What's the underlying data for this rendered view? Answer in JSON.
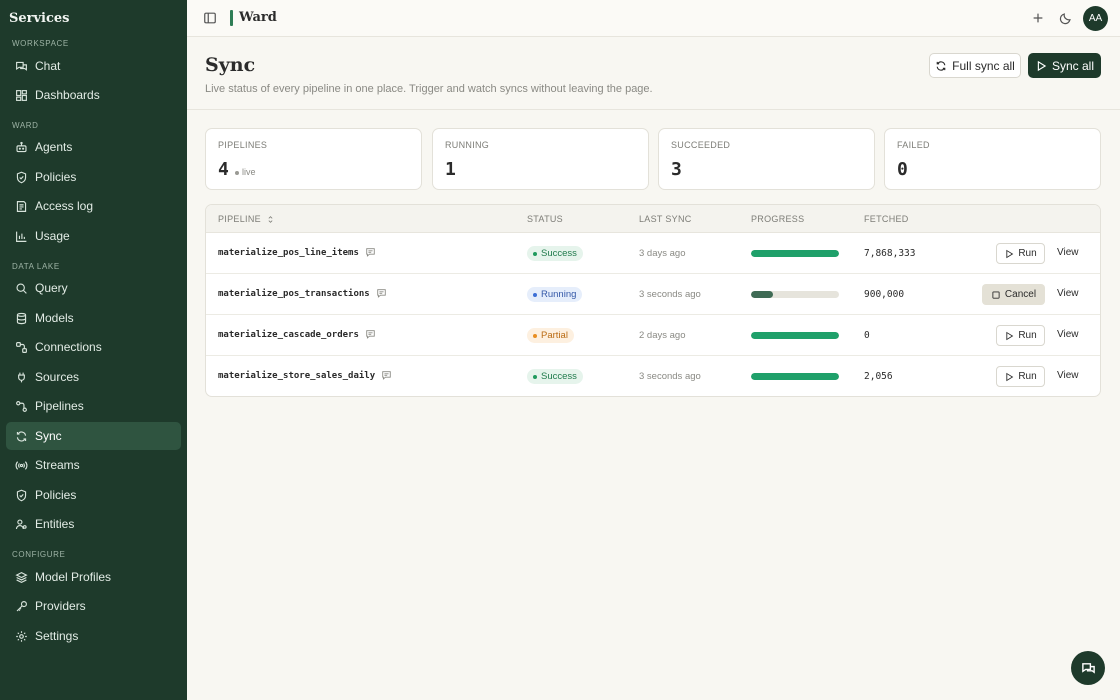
{
  "sidebar": {
    "brand": "Services",
    "sections": {
      "workspace": "WORKSPACE",
      "ward": "WARD",
      "data_lake": "DATA LAKE",
      "configure": "CONFIGURE"
    },
    "items": {
      "chat": "Chat",
      "dashboards": "Dashboards",
      "agents": "Agents",
      "policies_ward": "Policies",
      "access_log": "Access log",
      "usage": "Usage",
      "query": "Query",
      "models": "Models",
      "connections": "Connections",
      "sources": "Sources",
      "pipelines": "Pipelines",
      "sync": "Sync",
      "streams": "Streams",
      "policies_lake": "Policies",
      "entities": "Entities",
      "model_profiles": "Model Profiles",
      "providers": "Providers",
      "settings": "Settings"
    },
    "active_item": "Sync"
  },
  "topbar": {
    "workspace_name": "Ward",
    "avatar_initials": "AA"
  },
  "page": {
    "title": "Sync",
    "subtitle": "Live status of every pipeline in one place. Trigger and watch syncs without leaving the page.",
    "full_sync_label": "Full sync all",
    "sync_all_label": "Sync all"
  },
  "stats": {
    "pipelines": {
      "label": "PIPELINES",
      "value": "4",
      "note": "live"
    },
    "running": {
      "label": "RUNNING",
      "value": "1"
    },
    "succeeded": {
      "label": "SUCCEEDED",
      "value": "3"
    },
    "failed": {
      "label": "FAILED",
      "value": "0"
    }
  },
  "table": {
    "headers": {
      "pipeline": "PIPELINE",
      "status": "STATUS",
      "last_sync": "LAST SYNC",
      "progress": "PROGRESS",
      "fetched": "FETCHED"
    },
    "rows": [
      {
        "name": "materialize_pos_line_items",
        "status": "Success",
        "last_sync": "3 days ago",
        "progress": 1.0,
        "fetched": "7,868,333",
        "action": "Run",
        "view": "View"
      },
      {
        "name": "materialize_pos_transactions",
        "status": "Running",
        "last_sync": "3 seconds ago",
        "progress": 0.25,
        "fetched": "900,000",
        "action": "Cancel",
        "view": "View"
      },
      {
        "name": "materialize_cascade_orders",
        "status": "Partial",
        "last_sync": "2 days ago",
        "progress": 1.0,
        "fetched": "0",
        "action": "Run",
        "view": "View"
      },
      {
        "name": "materialize_store_sales_daily",
        "status": "Success",
        "last_sync": "3 seconds ago",
        "progress": 1.0,
        "fetched": "2,056",
        "action": "Run",
        "view": "View"
      }
    ]
  },
  "colors": {
    "sidebar_bg": "#1e3a2b",
    "accent_green": "#1fa06a",
    "running_fill": "#3f6b55"
  }
}
